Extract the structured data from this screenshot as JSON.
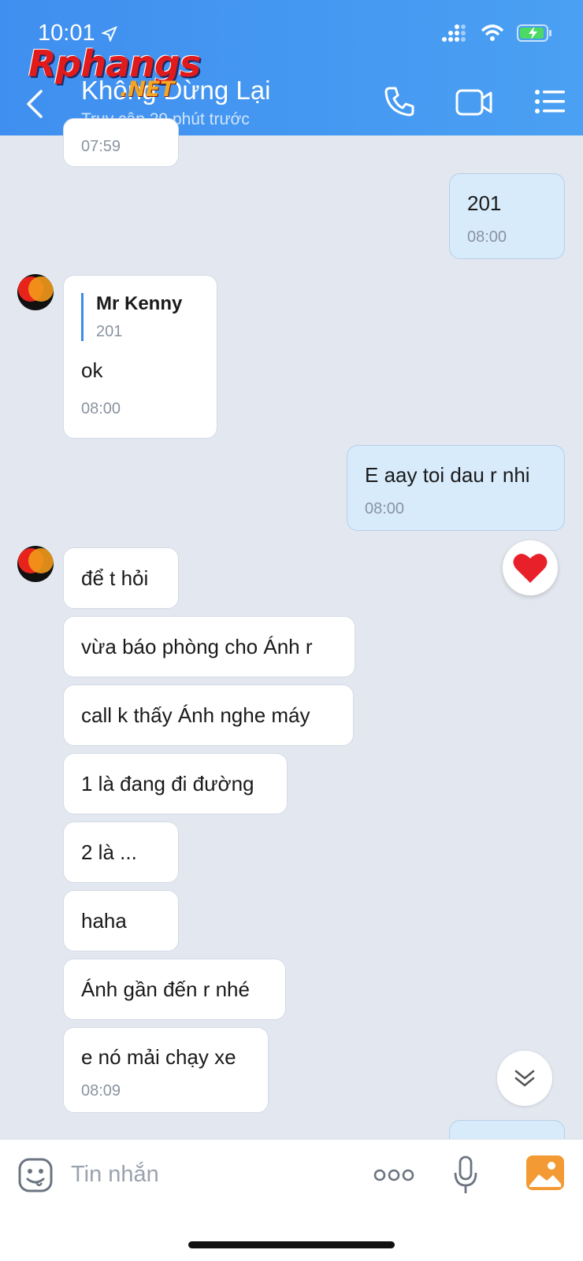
{
  "status_bar": {
    "time": "10:01"
  },
  "header": {
    "title": "Không Dừng Lại",
    "subtitle": "Truy cập 29 phút trước"
  },
  "watermark": {
    "main": "Rphangs",
    "sub": ".NET"
  },
  "messages": {
    "m0": {
      "time": "07:59"
    },
    "m1": {
      "text": "201",
      "time": "08:00"
    },
    "m2": {
      "quote_name": "Mr Kenny",
      "quote_text": "201",
      "text": "ok",
      "time": "08:00"
    },
    "m3": {
      "text": "E aay toi dau r nhi",
      "time": "08:00"
    },
    "m4": {
      "text": "để t hỏi"
    },
    "m5": {
      "text": "vừa báo phòng cho Ánh r"
    },
    "m6": {
      "text": "call k thấy Ánh nghe máy"
    },
    "m7": {
      "text": "1 là đang đi đường"
    },
    "m8": {
      "text": "2 là ..."
    },
    "m9": {
      "text": "haha"
    },
    "m10": {
      "text": "Ánh gần đến r nhé"
    },
    "m11": {
      "text": "e nó mải chạy xe",
      "time": "08:09"
    }
  },
  "reaction": {
    "icon": "heart-icon"
  },
  "input": {
    "placeholder": "Tin nhắn"
  },
  "colors": {
    "header": "#4a9af1",
    "my_bubble": "#d8ebfb",
    "background": "#e3e8f0",
    "accent": "#3d8de8"
  }
}
